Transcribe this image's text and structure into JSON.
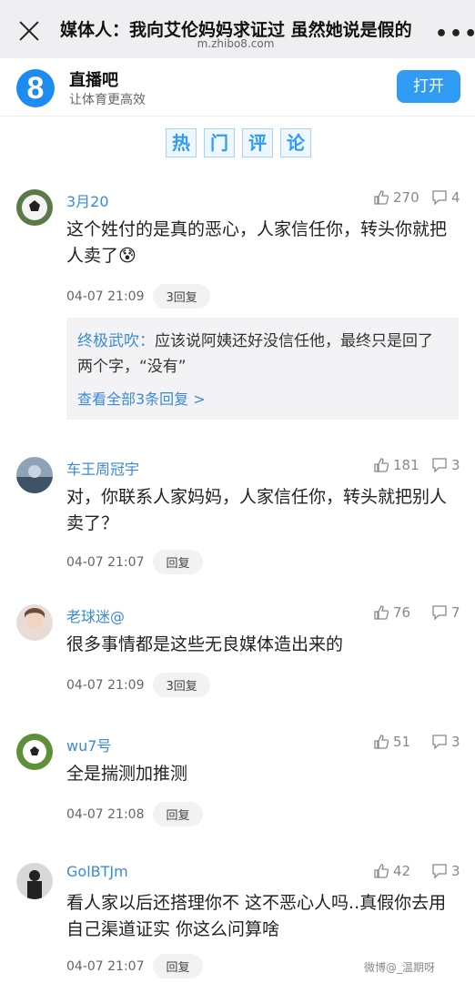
{
  "browser": {
    "title": "媒体人：我向艾伦妈妈求证过 虽然她说是假的",
    "url": "m.zhibo8.com",
    "more": "•••"
  },
  "app_banner": {
    "logo_text": "8",
    "name": "直播吧",
    "slogan": "让体育更高效",
    "open_label": "打开"
  },
  "section_title": [
    "热",
    "门",
    "评",
    "论"
  ],
  "comments": [
    {
      "user": "3月20",
      "likes": "270",
      "replies": "4",
      "text": "这个姓付的是真的恶心，人家信任你，转头你就把人卖了😰",
      "time": "04-07 21:09",
      "reply_label": "3回复",
      "sub": {
        "name": "终极武吹",
        "sep": "：",
        "text": "应该说阿姨还好没信任他，最终只是回了两个字，“没有”",
        "view_all": "查看全部3条回复 >"
      }
    },
    {
      "user": "车王周冠宇",
      "likes": "181",
      "replies": "3",
      "text": "对，你联系人家妈妈，人家信任你，转头就把别人卖了？",
      "time": "04-07 21:07",
      "reply_label": "回复"
    },
    {
      "user": "老球迷@",
      "likes": "76",
      "replies": "7",
      "text": "很多事情都是这些无良媒体造出来的",
      "time": "04-07 21:09",
      "reply_label": "3回复"
    },
    {
      "user": "wu7号",
      "likes": "51",
      "replies": "3",
      "text": "全是揣测加推测",
      "time": "04-07 21:08",
      "reply_label": "回复"
    },
    {
      "user": "GolBTJm",
      "likes": "42",
      "replies": "3",
      "text": "看人家以后还搭理你不 这不恶心人吗..真假你去用自己渠道证实 你这么问算啥",
      "time": "04-07 21:07",
      "reply_label": "回复"
    }
  ],
  "watermark": "微博@_温期呀",
  "colors": {
    "accent": "#2f9bf2",
    "username": "#3b8ad6",
    "topbar_bg": "#efeff1"
  },
  "icons": [
    "close-icon",
    "more-icon",
    "thumbs-up-icon",
    "comment-icon"
  ]
}
